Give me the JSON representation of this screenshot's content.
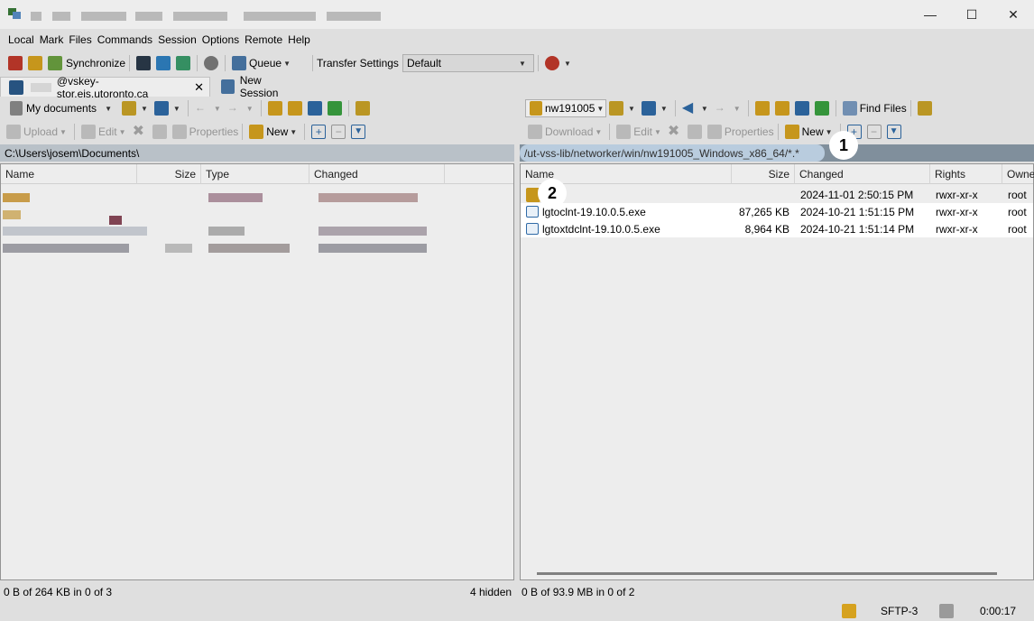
{
  "menu": [
    "Local",
    "Mark",
    "Files",
    "Commands",
    "Session",
    "Options",
    "Remote",
    "Help"
  ],
  "toolbar": {
    "synchronize": "Synchronize",
    "queue": "Queue",
    "transfer_settings_label": "Transfer Settings",
    "transfer_settings_value": "Default"
  },
  "tabs": {
    "session": "@vskey-stor.eis.utoronto.ca",
    "new_session": "New Session"
  },
  "left": {
    "location": "My documents",
    "upload": "Upload",
    "edit": "Edit",
    "properties": "Properties",
    "new": "New",
    "path": "C:\\Users\\josem\\Documents\\",
    "columns": [
      "Name",
      "Size",
      "Type",
      "Changed"
    ],
    "status": "0 B of 264 KB in 0 of 3",
    "hidden": "4 hidden"
  },
  "right": {
    "location": "nw191005",
    "find_files": "Find Files",
    "download": "Download",
    "edit": "Edit",
    "properties": "Properties",
    "new": "New",
    "path": "/ut-vss-lib/networker/win/nw191005_Windows_x86_64/*.*",
    "columns": [
      "Name",
      "Size",
      "Changed",
      "Rights",
      "Owne"
    ],
    "rows": [
      {
        "name": "",
        "size": "",
        "changed": "2024-11-01 2:50:15 PM",
        "rights": "rwxr-xr-x",
        "owner": "root"
      },
      {
        "name": "lgtoclnt-19.10.0.5.exe",
        "size": "87,265 KB",
        "changed": "2024-10-21 1:51:15 PM",
        "rights": "rwxr-xr-x",
        "owner": "root"
      },
      {
        "name": "lgtoxtdclnt-19.10.0.5.exe",
        "size": "8,964 KB",
        "changed": "2024-10-21 1:51:14 PM",
        "rights": "rwxr-xr-x",
        "owner": "root"
      }
    ],
    "status": "0 B of 93.9 MB in 0 of 2"
  },
  "statusbar": {
    "protocol": "SFTP-3",
    "time": "0:00:17"
  },
  "annotations": {
    "badge1": "1",
    "badge2": "2"
  }
}
